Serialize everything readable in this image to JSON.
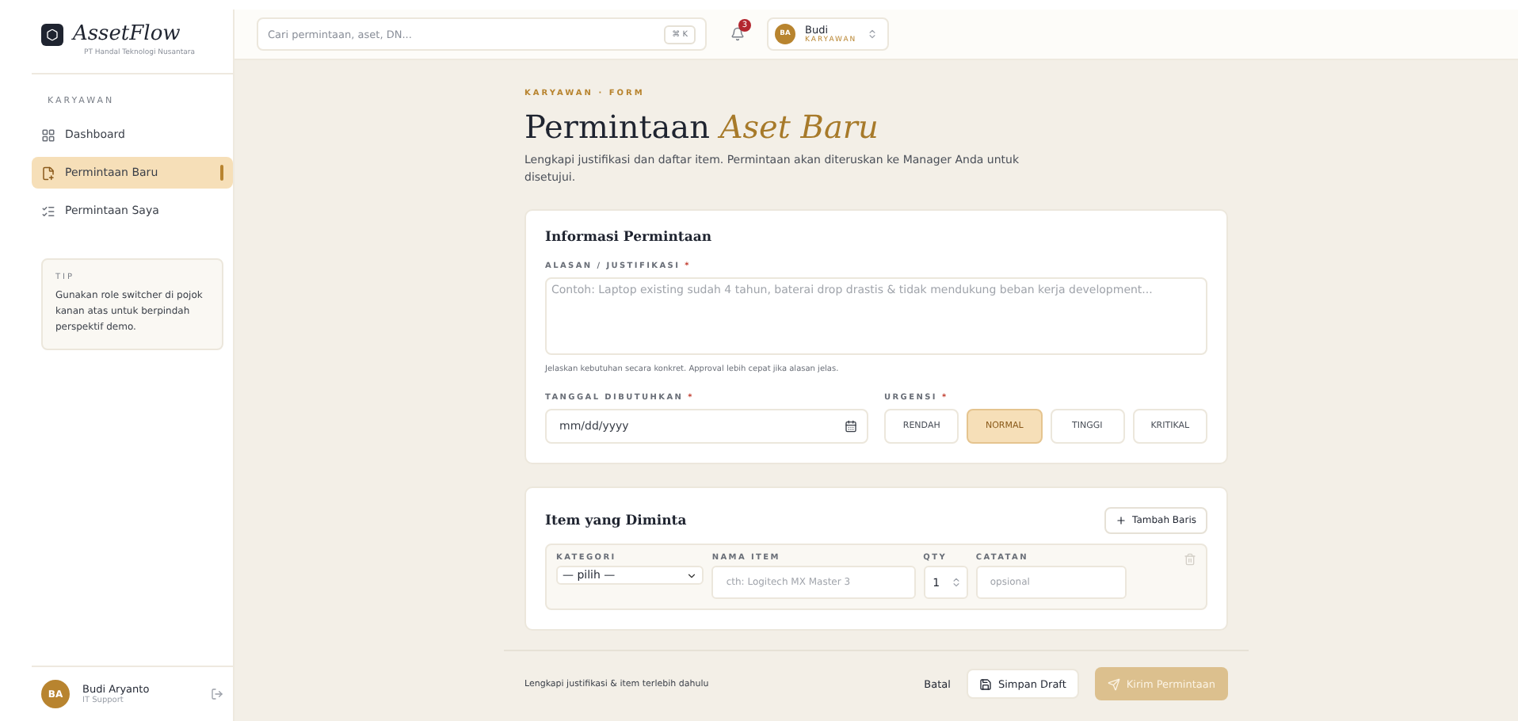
{
  "brand": {
    "name": "AssetFlow",
    "company": "PT Handal Teknologi Nusantara"
  },
  "sidebar": {
    "section": "KARYAWAN",
    "items": [
      {
        "label": "Dashboard",
        "selected": false
      },
      {
        "label": "Permintaan Baru",
        "selected": true
      },
      {
        "label": "Permintaan Saya",
        "selected": false
      }
    ],
    "tip": {
      "title": "TIP",
      "text": "Gunakan role switcher di pojok kanan atas untuk berpindah perspektif demo."
    },
    "user": {
      "initials": "BA",
      "name": "Budi Aryanto",
      "role": "IT Support"
    }
  },
  "topbar": {
    "search": {
      "placeholder": "Cari permintaan, aset, DN...",
      "shortcut": "⌘ K"
    },
    "notifications": "3",
    "user": {
      "initials": "BA",
      "name": "Budi",
      "role": "KARYAWAN"
    }
  },
  "page": {
    "breadcrumb": "KARYAWAN · FORM",
    "title": "Permintaan",
    "title_accent": "Aset Baru",
    "subtitle": "Lengkapi justifikasi dan daftar item. Permintaan akan diteruskan ke Manager Anda untuk disetujui."
  },
  "info_card": {
    "title": "Informasi Permintaan",
    "reason": {
      "label": "ALASAN / JUSTIFIKASI",
      "required_mark": "*",
      "placeholder": "Contoh: Laptop existing sudah 4 tahun, baterai drop drastis & tidak mendukung beban kerja development...",
      "hint": "Jelaskan kebutuhan secara konkret. Approval lebih cepat jika alasan jelas."
    },
    "date": {
      "label": "TANGGAL DIBUTUHKAN",
      "required_mark": "*",
      "placeholder": "mm/dd/yyyy"
    },
    "urgency": {
      "label": "URGENSI",
      "required_mark": "*",
      "options": [
        {
          "label": "RENDAH",
          "selected": false
        },
        {
          "label": "NORMAL",
          "selected": true
        },
        {
          "label": "TINGGI",
          "selected": false
        },
        {
          "label": "KRITIKAL",
          "selected": false
        }
      ]
    }
  },
  "items_card": {
    "title": "Item yang Diminta",
    "add_button": "Tambah Baris",
    "columns": [
      "KATEGORI",
      "NAMA ITEM",
      "QTY",
      "CATATAN"
    ],
    "rows": [
      {
        "category": "— pilih —",
        "name_placeholder": "cth: Logitech MX Master 3",
        "qty": "1",
        "note_placeholder": "opsional"
      }
    ]
  },
  "footer": {
    "status": "Lengkapi justifikasi & item terlebih dahulu",
    "cancel": "Batal",
    "draft": "Simpan Draft",
    "submit": "Kirim Permintaan",
    "submit_disabled": true
  }
}
